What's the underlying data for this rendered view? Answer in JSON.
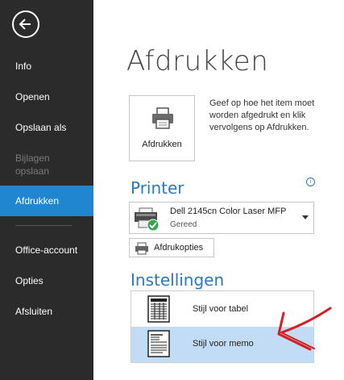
{
  "sidebar": {
    "items": [
      {
        "label": "Info"
      },
      {
        "label": "Openen"
      },
      {
        "label": "Opslaan als"
      },
      {
        "label": "Bijlagen opslaan"
      },
      {
        "label": "Afdrukken"
      },
      {
        "label": "Office-account"
      },
      {
        "label": "Opties"
      },
      {
        "label": "Afsluiten"
      }
    ],
    "active_item": "Afdrukken",
    "disabled_item": "Bijlagen opslaan"
  },
  "page": {
    "title": "Afdrukken"
  },
  "print_section": {
    "button_label": "Afdrukken",
    "description": "Geef op hoe het item moet worden afgedrukt en klik vervolgens op Afdrukken."
  },
  "printer": {
    "heading": "Printer",
    "name": "Dell 2145cn Color Laser MFP",
    "status": "Gereed",
    "properties_label": "Afdrukopties",
    "info_glyph": "i"
  },
  "settings": {
    "heading": "Instellingen",
    "styles": [
      {
        "label": "Stijl voor tabel"
      },
      {
        "label": "Stijl voor memo"
      }
    ],
    "selected_style": "Stijl voor memo"
  },
  "colors": {
    "sidebar_bg": "#2b2b2b",
    "accent": "#1f86cf",
    "heading": "#2b79bc",
    "selected_bg": "#c1dcf4",
    "annotation": "#d32020"
  },
  "icons": [
    "back-arrow-icon",
    "printer-icon",
    "printer-ready-icon",
    "properties-icon",
    "table-style-icon",
    "memo-style-icon"
  ]
}
